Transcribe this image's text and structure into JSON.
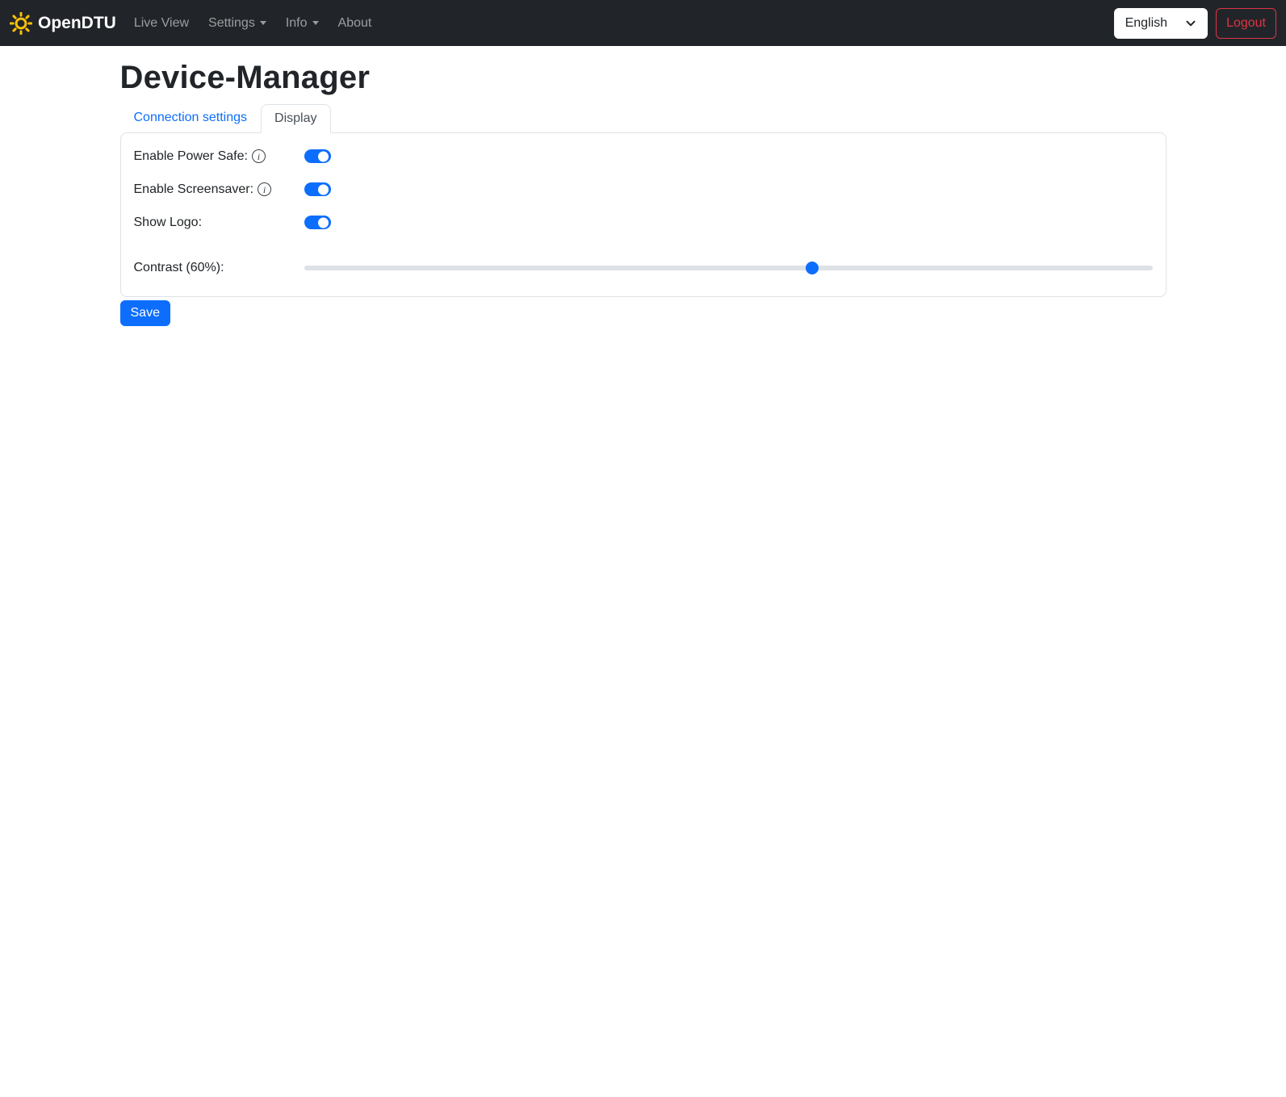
{
  "navbar": {
    "brand": "OpenDTU",
    "items": [
      {
        "label": "Live View",
        "dropdown": false
      },
      {
        "label": "Settings",
        "dropdown": true
      },
      {
        "label": "Info",
        "dropdown": true
      },
      {
        "label": "About",
        "dropdown": false
      }
    ],
    "language": {
      "selected": "English"
    },
    "logout_label": "Logout"
  },
  "page": {
    "title": "Device-Manager",
    "tabs": [
      {
        "label": "Connection settings",
        "active": false
      },
      {
        "label": "Display",
        "active": true
      }
    ]
  },
  "form": {
    "rows": [
      {
        "label": "Enable Power Safe:",
        "type": "switch",
        "checked": true,
        "info": true
      },
      {
        "label": "Enable Screensaver:",
        "type": "switch",
        "checked": true,
        "info": true
      },
      {
        "label": "Show Logo:",
        "type": "switch",
        "checked": true,
        "info": false
      },
      {
        "label": "Contrast (60%):",
        "type": "range",
        "value": 60,
        "min": 0,
        "max": 100
      }
    ],
    "save_label": "Save"
  },
  "icons": {
    "brand": "sun-icon",
    "nav_dropdown": "caret-down-icon",
    "language": "chevron-down-icon",
    "row_help": "info-icon"
  },
  "colors": {
    "primary": "#0d6efd",
    "danger": "#dc3545",
    "navbar_bg": "#212529",
    "card_border": "#dee2e6",
    "slider_track": "#dee2e6",
    "sun": "#ffc107",
    "inactive_tab_link": "#0d6efd",
    "active_tab_text": "#495057"
  }
}
